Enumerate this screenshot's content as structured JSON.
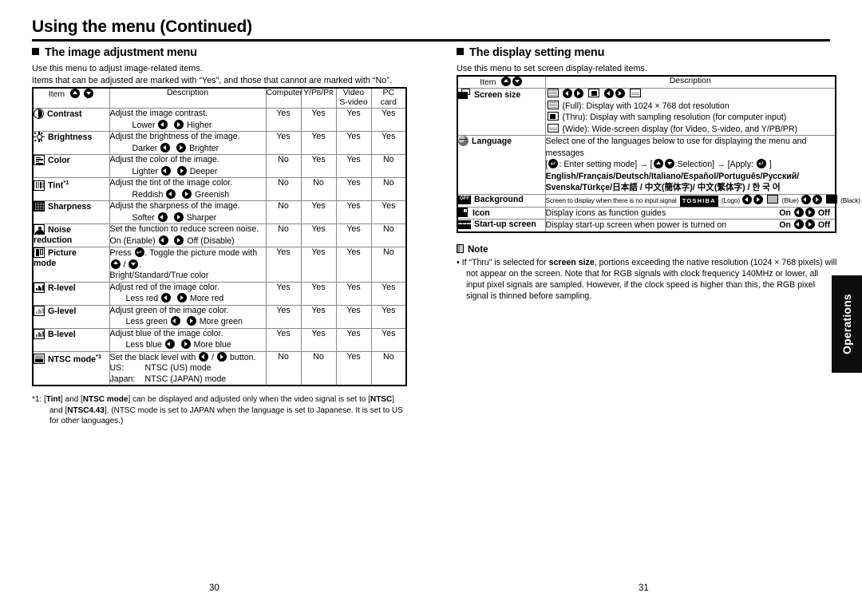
{
  "page": {
    "title": "Using the menu (Continued)",
    "page_number_left": "30",
    "page_number_right": "31",
    "side_tab_label": "Operations"
  },
  "left": {
    "section_heading": "The image adjustment menu",
    "lead_1": "Use this menu to adjust image-related items.",
    "lead_2": "Items that can be adjusted are marked with  “Yes”, and those that cannot are marked with “No”.",
    "table": {
      "headers": {
        "item": "Item",
        "description": "Description",
        "computer": "Computer",
        "ypbpr": "Y/PB/PR",
        "video_1": "Video",
        "video_2": "S-video",
        "pc_1": "PC",
        "pc_2": "card"
      },
      "rows": [
        {
          "icon": "contrast-icon",
          "item": "Contrast",
          "desc_line1": "Adjust the image contrast.",
          "desc_left": "Lower",
          "desc_right": "Higher",
          "computer": "Yes",
          "ypbpr": "Yes",
          "video": "Yes",
          "pccard": "Yes"
        },
        {
          "icon": "brightness-icon",
          "item": "Brightness",
          "desc_line1": "Adjust the brightness of the image.",
          "desc_left": "Darker",
          "desc_right": "Brighter",
          "computer": "Yes",
          "ypbpr": "Yes",
          "video": "Yes",
          "pccard": "Yes"
        },
        {
          "icon": "color-icon",
          "item": "Color",
          "desc_line1": "Adjust the color of the image.",
          "desc_left": "Lighter",
          "desc_right": "Deeper",
          "computer": "No",
          "ypbpr": "Yes",
          "video": "Yes",
          "pccard": "No"
        },
        {
          "icon": "tint-icon",
          "item": "Tint",
          "item_sup": "*1",
          "desc_line1": "Adjust the tint of the image color.",
          "desc_left": "Reddish",
          "desc_right": "Greenish",
          "computer": "No",
          "ypbpr": "No",
          "video": "Yes",
          "pccard": "No"
        },
        {
          "icon": "sharpness-icon",
          "item": "Sharpness",
          "desc_line1": "Adjust the sharpness of the image.",
          "desc_left": "Softer",
          "desc_right": "Sharper",
          "computer": "No",
          "ypbpr": "Yes",
          "video": "Yes",
          "pccard": "Yes"
        },
        {
          "icon": "noise-reduction-icon",
          "item": "Noise",
          "item_line2": "reduction",
          "desc_line1": "Set the function to reduce screen noise.",
          "desc_left": "On (Enable)",
          "desc_right": "Off (Disable)",
          "computer": "No",
          "ypbpr": "Yes",
          "video": "Yes",
          "pccard": "No"
        },
        {
          "icon": "picture-mode-icon",
          "item": "Picture",
          "item_line2": "mode",
          "desc_press": "Press",
          "desc_press_tail": ". Toggle the picture mode with",
          "desc_slash": "/",
          "desc_period": ".",
          "desc_line3": "Bright/Standard/True color",
          "computer": "Yes",
          "ypbpr": "Yes",
          "video": "Yes",
          "pccard": "No"
        },
        {
          "icon": "r-level-icon",
          "item": "R-level",
          "desc_line1": "Adjust red of the image color.",
          "desc_left": "Less red",
          "desc_right": "More red",
          "computer": "Yes",
          "ypbpr": "Yes",
          "video": "Yes",
          "pccard": "Yes"
        },
        {
          "icon": "g-level-icon",
          "item": "G-level",
          "desc_line1": "Adjust green of the image color.",
          "desc_left": "Less green",
          "desc_right": "More green",
          "computer": "Yes",
          "ypbpr": "Yes",
          "video": "Yes",
          "pccard": "Yes"
        },
        {
          "icon": "b-level-icon",
          "item": "B-level",
          "desc_line1": "Adjust blue of the image color.",
          "desc_left": "Less blue",
          "desc_right": "More blue",
          "computer": "Yes",
          "ypbpr": "Yes",
          "video": "Yes",
          "pccard": "Yes"
        },
        {
          "icon": "ntsc-mode-icon",
          "item": "NTSC mode",
          "item_sup": "*1",
          "desc_black_a": "Set the black level with",
          "desc_black_slash": "/",
          "desc_black_b": "button.",
          "desc_us": "US:",
          "desc_us_val": "NTSC (US) mode",
          "desc_jp": "Japan:",
          "desc_jp_val": "NTSC (JAPAN) mode",
          "computer": "No",
          "ypbpr": "No",
          "video": "Yes",
          "pccard": "No"
        }
      ]
    },
    "footnote": {
      "marker": "*1:",
      "p1a": "[",
      "p1b": "Tint",
      "p1c": "] and [",
      "p1d": "NTSC mode",
      "p1e": "] can be displayed and adjusted only when the video signal is set to [",
      "p1f": "NTSC",
      "p1g": "] and [",
      "p1h": "NTSC4.43",
      "p1i": "]. (NTSC mode is set to JAPAN when the language is set to Japanese. It is set to US for other languages.)"
    }
  },
  "right": {
    "section_heading": "The display setting menu",
    "lead_1": "Use this menu to set screen display-related items.",
    "table": {
      "headers": {
        "item": "Item",
        "description": "Description"
      },
      "screen_size": {
        "item": "Screen size",
        "full_label": "(Full):",
        "full_text": "Display with 1024 × 768 dot resolution",
        "thru_label": "(Thru):",
        "thru_text": "Display with sampling resolution (for computer input)",
        "wide_label": "(Wide):",
        "wide_text": "Wide-screen display (for Video, S-video, and Y/PB/PR)"
      },
      "language": {
        "item": "Language",
        "line1": "Select one of the languages below to use for displaying the menu and messages",
        "line2_a": "[",
        "line2_b": ": Enter setting mode] → [",
        "line2_c": ":Selection] → [Apply:",
        "line2_d": "]",
        "line3": "English/Français/Deutsch/Italiano/Español/Português/Русский/",
        "line4": "Svenska/Türkçe/日本語 / 中文(簡体字)/ 中文(繁体字) / 한 국 어"
      },
      "background": {
        "item": "Background",
        "text": "Screen to display when there is no input signal",
        "logo_text": "TOSHIBA",
        "logo_label": "(Logo)",
        "blue_label": "(Blue)",
        "black_label": "(Black)"
      },
      "icon_row": {
        "item": "Icon",
        "text": "Display icons as function guides",
        "on": "On",
        "off": "Off"
      },
      "startup": {
        "item": "Start-up screen",
        "text": "Display start-up screen when power is turned on",
        "on": "On",
        "off": "Off"
      }
    },
    "note": {
      "heading": "Note",
      "bullet": "•",
      "a": "If “Thru” is selected for ",
      "b": "screen size",
      "c": ", portions exceeding the native resolution (1024 × 768 pixels) will not appear on the screen. Note that for RGB signals with clock frequency 140MHz or lower, all input pixel signals are sampled. However, if the clock speed is higher than this, the RGB pixel signal is thinned before sampling."
    }
  }
}
